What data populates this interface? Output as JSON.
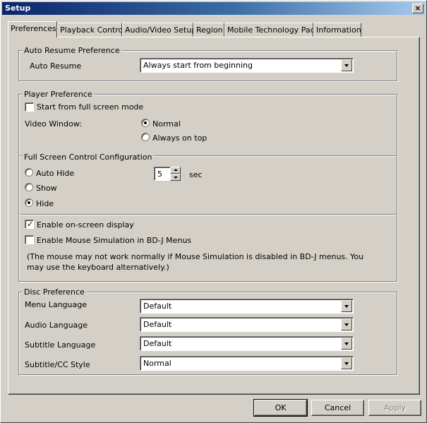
{
  "window": {
    "title": "Setup",
    "close_label": "×"
  },
  "tabs": [
    {
      "label": "Preferences",
      "active": true
    },
    {
      "label": "Playback Control",
      "active": false
    },
    {
      "label": "Audio/Video Setup",
      "active": false
    },
    {
      "label": "Region",
      "active": false
    },
    {
      "label": "Mobile Technology Pack",
      "active": false
    },
    {
      "label": "Information",
      "active": false
    }
  ],
  "auto_resume": {
    "group_title": "Auto Resume Preference",
    "label": "Auto Resume",
    "value": "Always start from beginning"
  },
  "player": {
    "group_title": "Player Preference",
    "full_screen_label": "Start from full screen mode",
    "full_screen_checked": false,
    "video_window_label": "Video Window:",
    "video_window_options": [
      "Normal",
      "Always on top"
    ],
    "video_window_selected": "Normal",
    "fs_control_title": "Full Screen Control Configuration",
    "fs_control_options": [
      "Auto Hide",
      "Show",
      "Hide"
    ],
    "fs_control_selected": "Hide",
    "auto_hide_seconds": "5",
    "seconds_unit": "sec",
    "osd_label": "Enable on-screen display",
    "osd_checked": true,
    "mouse_sim_label": "Enable Mouse Simulation in BD-J Menus",
    "mouse_sim_checked": false,
    "mouse_note": "(The mouse may not work normally if Mouse Simulation is disabled in BD-J menus. You may use the keyboard alternatively.)"
  },
  "disc": {
    "group_title": "Disc Preference",
    "menu_language_label": "Menu Language",
    "menu_language_value": "Default",
    "audio_language_label": "Audio Language",
    "audio_language_value": "Default",
    "subtitle_language_label": "Subtitle Language",
    "subtitle_language_value": "Default",
    "subtitle_style_label": "Subtitle/CC Style",
    "subtitle_style_value": "Normal"
  },
  "buttons": {
    "ok": "OK",
    "cancel": "Cancel",
    "apply": "Apply"
  },
  "colors": {
    "face": "#d4d0c8",
    "title_start": "#0a246a",
    "title_end": "#a6caf0"
  }
}
